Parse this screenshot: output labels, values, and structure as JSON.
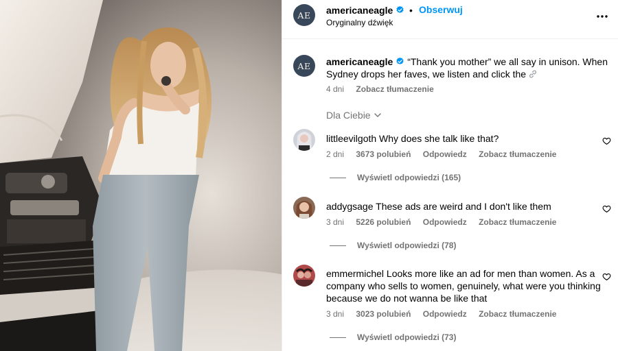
{
  "post": {
    "account": "americaneagle",
    "avatar_initials": "AE",
    "follow_label": "Obserwuj",
    "separator": "•",
    "audio": "Oryginalny dźwięk",
    "more_icon": "more-horizontal-icon"
  },
  "caption": {
    "username": "americaneagle",
    "text": "“Thank you mother” we all say in unison. When Sydney drops her faves, we listen and click the",
    "link_icon": "link-icon",
    "time": "4 dni",
    "translate": "Zobacz tłumaczenie"
  },
  "filter": {
    "label": "Dla Ciebie",
    "icon": "chevron-down-icon"
  },
  "comments": [
    {
      "username": "littleevilgoth",
      "text": "Why does she talk like that?",
      "time": "2 dni",
      "likes": "3673 polubień",
      "reply": "Odpowiedz",
      "translate": "Zobacz tłumaczenie",
      "view_replies": "Wyświetl odpowiedzi (165)"
    },
    {
      "username": "addygsage",
      "text": "These ads are weird and I don't like them",
      "time": "3 dni",
      "likes": "5226 polubień",
      "reply": "Odpowiedz",
      "translate": "Zobacz tłumaczenie",
      "view_replies": "Wyświetl odpowiedzi (78)"
    },
    {
      "username": "emmermichel",
      "text": "Looks more like an ad for men than women. As a company who sells to women, genuinely, what were you thinking because we do not wanna be like that",
      "time": "3 dni",
      "likes": "3023 polubień",
      "reply": "Odpowiedz",
      "translate": "Zobacz tłumaczenie",
      "view_replies": "Wyświetl odpowiedzi (73)"
    }
  ],
  "colors": {
    "accent": "#0095f6",
    "verified": "#0095f6",
    "secondary_text": "#737373",
    "avatar_bg": "#38485a"
  }
}
